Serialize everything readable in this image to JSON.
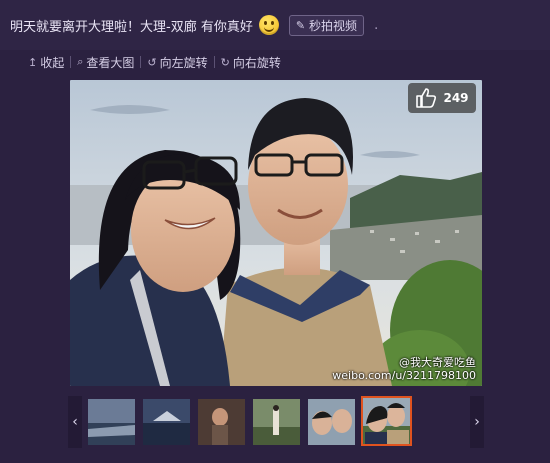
{
  "post": {
    "text": "明天就要离开大理啦！大理-双廊 有你真好",
    "emoji": "smiley-emoji",
    "video_tag": "秒拍视频",
    "trailing": "."
  },
  "toolbar": {
    "collapse": "收起",
    "view_large": "查看大图",
    "rotate_left": "向左旋转",
    "rotate_right": "向右旋转"
  },
  "photo": {
    "likes": "249",
    "watermark_name": "@我大奇爱吃鱼",
    "watermark_url": "weibo.com/u/3211798100"
  },
  "thumbnails": {
    "count": 6,
    "active_index": 5
  },
  "colors": {
    "background": "#2b2140",
    "active_border": "#e0531f"
  }
}
